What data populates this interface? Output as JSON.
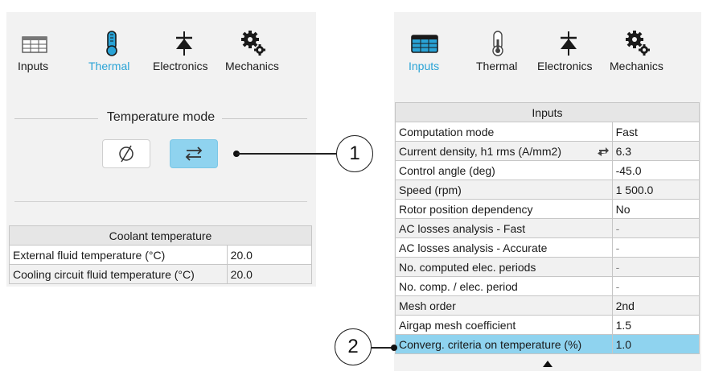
{
  "left": {
    "toolbar": {
      "inputs": "Inputs",
      "thermal": "Thermal",
      "electronics": "Electronics",
      "mechanics": "Mechanics",
      "active": "thermal"
    },
    "temperature_mode": {
      "title": "Temperature mode",
      "none_symbol": "Ø",
      "swap_symbol": "⇄",
      "selected": "swap"
    },
    "coolant_table": {
      "header": "Coolant temperature",
      "rows": [
        {
          "label": "External fluid temperature (°C)",
          "value": "20.0"
        },
        {
          "label": "Cooling circuit fluid temperature (°C)",
          "value": "20.0"
        }
      ]
    }
  },
  "right": {
    "toolbar": {
      "inputs": "Inputs",
      "thermal": "Thermal",
      "electronics": "Electronics",
      "mechanics": "Mechanics",
      "active": "inputs"
    },
    "inputs_table": {
      "header": "Inputs",
      "rows": [
        {
          "label": "Computation mode",
          "value": "Fast"
        },
        {
          "label": "Current density, h1 rms (A/mm2)",
          "value": "6.3"
        },
        {
          "label": "Control angle (deg)",
          "value": "-45.0"
        },
        {
          "label": "Speed (rpm)",
          "value": "1 500.0"
        },
        {
          "label": "Rotor position dependency",
          "value": "No"
        },
        {
          "label": "AC losses analysis - Fast",
          "value": "-"
        },
        {
          "label": "AC losses analysis - Accurate",
          "value": "-"
        },
        {
          "label": "No. computed elec. periods",
          "value": "-"
        },
        {
          "label": "No. comp. / elec. period",
          "value": "-"
        },
        {
          "label": "Mesh order",
          "value": "2nd"
        },
        {
          "label": "Airgap mesh coefficient",
          "value": "1.5"
        },
        {
          "label": "Converg. criteria on temperature (%)",
          "value": "1.0"
        }
      ],
      "selected_row": 11
    }
  },
  "callouts": {
    "one": "1",
    "two": "2"
  },
  "colors": {
    "accent": "#29a3d6",
    "selection": "#8fd3ef",
    "panel_bg": "#f2f2f2"
  },
  "icons": [
    "table-icon",
    "thermometer-icon",
    "diode-icon",
    "gears-icon",
    "swap-arrows-icon",
    "exchange-arrows-icon",
    "scroll-up-arrow-icon"
  ]
}
